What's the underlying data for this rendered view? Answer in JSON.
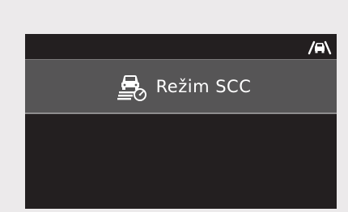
{
  "menu": {
    "item_label": "Režim SCC",
    "item_icon": "scc-speed-control-icon"
  },
  "status_bar": {
    "icon": "lane-assist-car-icon"
  },
  "colors": {
    "background": "#eceaeb",
    "screen": "#231f20",
    "highlight_row": "#565556",
    "text": "#ffffff"
  }
}
